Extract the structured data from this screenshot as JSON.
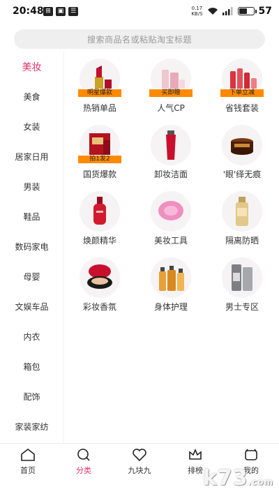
{
  "status_bar": {
    "time": "20:48",
    "net_speed_value": "0.17",
    "net_speed_unit": "KB/S",
    "battery_level": 57,
    "battery_text": "57"
  },
  "search": {
    "placeholder": "搜索商品名或粘贴淘宝标题"
  },
  "sidebar": {
    "items": [
      {
        "label": "美妆",
        "active": true
      },
      {
        "label": "美食"
      },
      {
        "label": "女装"
      },
      {
        "label": "居家日用"
      },
      {
        "label": "男装"
      },
      {
        "label": "鞋品"
      },
      {
        "label": "数码家电"
      },
      {
        "label": "母婴"
      },
      {
        "label": "文娱车品"
      },
      {
        "label": "内衣"
      },
      {
        "label": "箱包"
      },
      {
        "label": "配饰"
      },
      {
        "label": "家装家纺"
      }
    ]
  },
  "categories": [
    {
      "label": "热销单品",
      "tag": "明星爆款",
      "icon": "lipstick-icon"
    },
    {
      "label": "人气CP",
      "tag": "买即赠",
      "icon": "skincare-set-icon"
    },
    {
      "label": "省钱套装",
      "tag": "下单立减",
      "icon": "bottle-set-icon"
    },
    {
      "label": "国货爆款",
      "tag": "拍1发2",
      "icon": "mask-box-icon"
    },
    {
      "label": "卸妆洁面",
      "icon": "cleanser-tube-icon"
    },
    {
      "label": "'眼'绎无痕",
      "icon": "eye-cream-jar-icon"
    },
    {
      "label": "焕颜精华",
      "icon": "serum-bottle-icon"
    },
    {
      "label": "美妆工具",
      "icon": "face-brush-icon"
    },
    {
      "label": "隔离防晒",
      "icon": "sunscreen-bottle-icon"
    },
    {
      "label": "彩妆香氛",
      "icon": "compact-cushion-icon"
    },
    {
      "label": "身体护理",
      "icon": "body-oil-bottles-icon"
    },
    {
      "label": "男士专区",
      "icon": "mens-bottles-icon"
    }
  ],
  "bottom_nav": {
    "items": [
      {
        "label": "首页",
        "icon": "home-icon"
      },
      {
        "label": "分类",
        "icon": "search-icon",
        "active": true
      },
      {
        "label": "九块九",
        "icon": "heart-icon"
      },
      {
        "label": "排榜",
        "icon": "crown-icon"
      },
      {
        "label": "我的",
        "icon": "profile-icon"
      }
    ]
  },
  "watermark": {
    "text": "k73",
    "suffix": ".com"
  },
  "colors": {
    "accent": "#e8326b",
    "tag": "#ff8a00",
    "search_bg": "#efefef",
    "thumb_bg": "#f5f3f4"
  }
}
